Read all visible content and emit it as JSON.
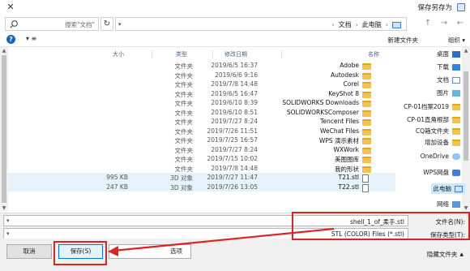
{
  "window": {
    "title": "保存另存为",
    "close_glyph": "✕"
  },
  "nav": {
    "crumbs": [
      "此电脑",
      "文档"
    ],
    "search_placeholder": "搜索\"文档\"",
    "refresh_glyph": "↻",
    "address_dropdown_glyph": "▾",
    "separator_glyph": "›",
    "back_glyph": "←",
    "forward_glyph": "→",
    "up_glyph": "↑"
  },
  "toolbar": {
    "organize_label": "组织 ▾",
    "new_folder_label": "新建文件夹",
    "help_glyph": "?",
    "view_toggle_label": "▾ ≡"
  },
  "columns": {
    "name": "名称",
    "date": "修改日期",
    "type": "类型",
    "size": "大小"
  },
  "files": [
    {
      "name": "Adobe",
      "date": "2019/6/5 16:37",
      "type": "文件夹",
      "size": "",
      "kind": "folder"
    },
    {
      "name": "Autodesk",
      "date": "2019/6/6 9:16",
      "type": "文件夹",
      "size": "",
      "kind": "folder"
    },
    {
      "name": "Corel",
      "date": "2019/7/8 14:48",
      "type": "文件夹",
      "size": "",
      "kind": "folder"
    },
    {
      "name": "KeyShot 8",
      "date": "2019/6/5 16:47",
      "type": "文件夹",
      "size": "",
      "kind": "folder"
    },
    {
      "name": "SOLIDWORKS Downloads",
      "date": "2019/6/10 8:39",
      "type": "文件夹",
      "size": "",
      "kind": "folder"
    },
    {
      "name": "SOLIDWORKSComposer",
      "date": "2019/6/10 8:51",
      "type": "文件夹",
      "size": "",
      "kind": "folder"
    },
    {
      "name": "Tencent Files",
      "date": "2019/7/27 8:24",
      "type": "文件夹",
      "size": "",
      "kind": "folder"
    },
    {
      "name": "WeChat Files",
      "date": "2019/7/26 11:51",
      "type": "文件夹",
      "size": "",
      "kind": "folder"
    },
    {
      "name": "WPS 演示素材",
      "date": "2019/7/25 16:57",
      "type": "文件夹",
      "size": "",
      "kind": "folder"
    },
    {
      "name": "WXWork",
      "date": "2019/7/27 8:24",
      "type": "文件夹",
      "size": "",
      "kind": "folder"
    },
    {
      "name": "美图图库",
      "date": "2019/7/15 10:02",
      "type": "文件夹",
      "size": "",
      "kind": "folder"
    },
    {
      "name": "我的形状",
      "date": "2019/7/8 14:48",
      "type": "文件夹",
      "size": "",
      "kind": "folder"
    },
    {
      "name": "T21.stl",
      "date": "2019/7/27 11:47",
      "type": "3D 对象",
      "size": "995 KB",
      "kind": "file"
    },
    {
      "name": "T22.stl",
      "date": "2019/7/26 13:05",
      "type": "3D 对象",
      "size": "247 KB",
      "kind": "file"
    }
  ],
  "sidebar": [
    {
      "label": "桌面",
      "icon": "desktop-icon"
    },
    {
      "label": "下载",
      "icon": "download-icon"
    },
    {
      "label": "文档",
      "icon": "documents-icon"
    },
    {
      "label": "图片",
      "icon": "pictures-icon"
    },
    {
      "label": "CP-01档案2019",
      "icon": "folder-icon"
    },
    {
      "label": "CP-01直角根部",
      "icon": "folder-icon"
    },
    {
      "label": "CQ箱文件夹",
      "icon": "folder-icon"
    },
    {
      "label": "增加设备",
      "icon": "folder-icon"
    },
    {
      "label": "OneDrive",
      "icon": "cloud-icon"
    },
    {
      "label": "WPS网盘",
      "icon": "wps-icon"
    },
    {
      "label": "此电脑",
      "icon": "computer-icon"
    },
    {
      "label": "网络",
      "icon": "network-icon"
    }
  ],
  "form": {
    "filename_label": "文件名(N):",
    "filename_value": "shell_1_of_柔手.stl",
    "filetype_label": "保存类型(T):",
    "filetype_value": "STL (COLOR) Files (*.stl)",
    "dropdown_glyph": "▾"
  },
  "footer": {
    "hide_folders_label": "隐藏文件夹",
    "hide_folders_caret": "▲",
    "save_label": "保存(S)",
    "cancel_label": "取消",
    "options_label": "选项",
    "options_caret": "▾"
  },
  "annotation_color": "#e02222"
}
